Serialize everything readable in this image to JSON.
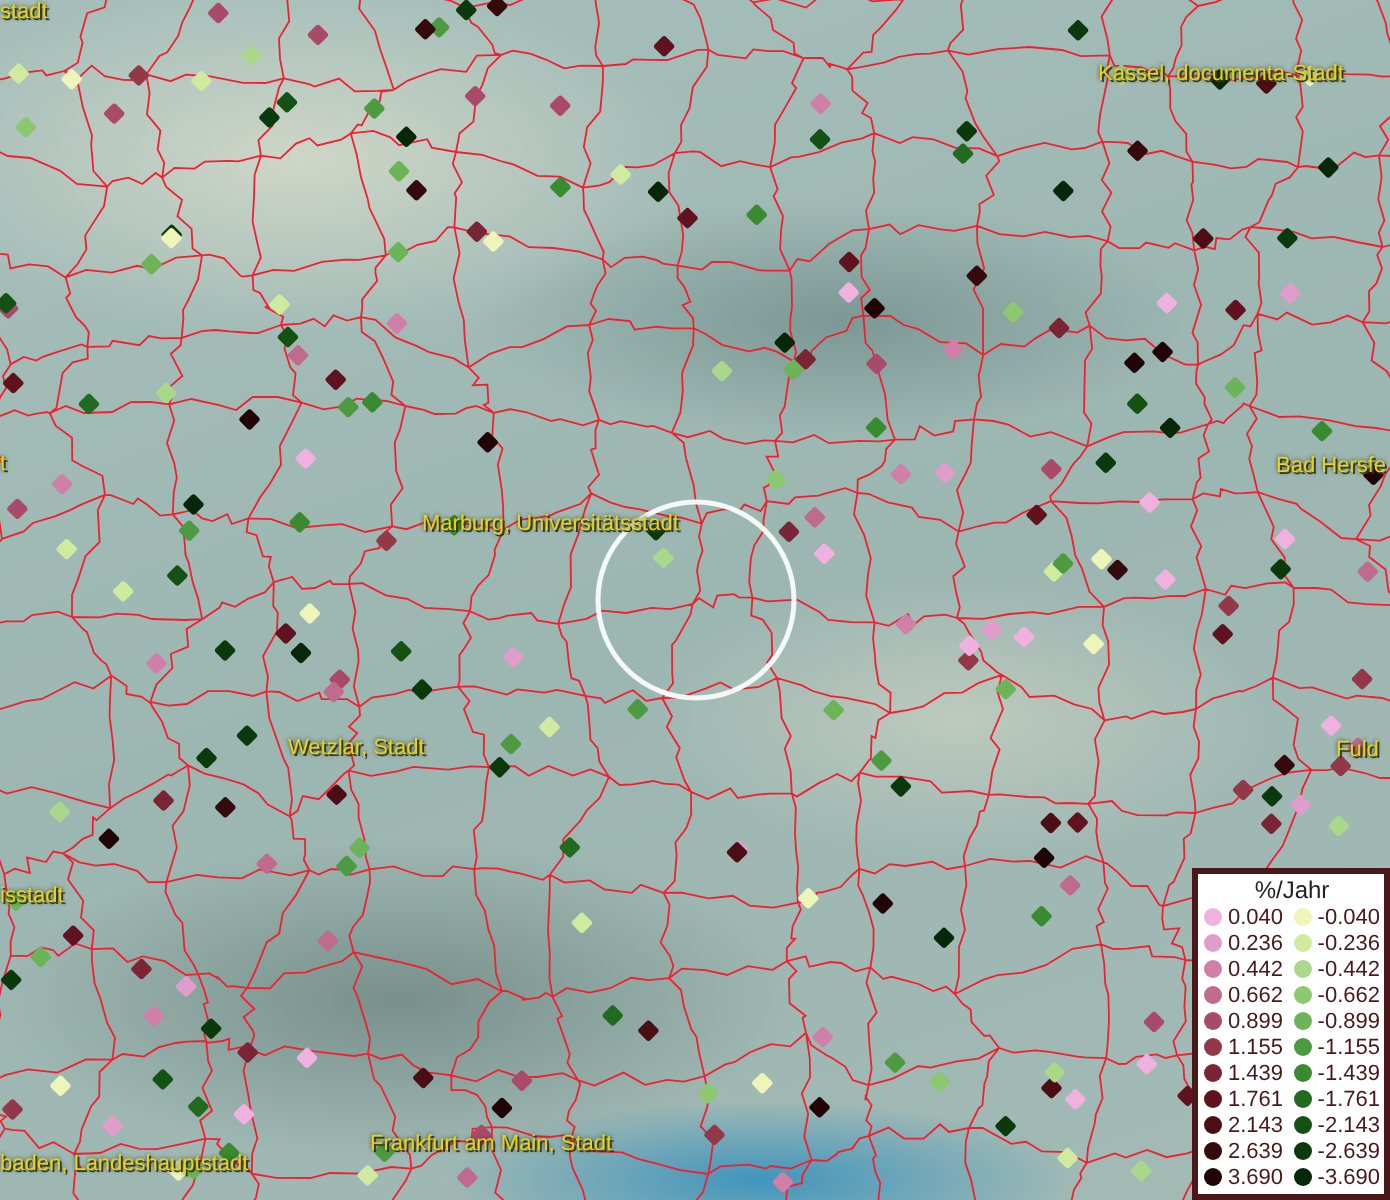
{
  "map": {
    "labels": [
      {
        "text": "stadt"
      },
      {
        "text": "Kassel, documenta-Stadt"
      },
      {
        "text": "t"
      },
      {
        "text": "Bad Hersfe"
      },
      {
        "text": "Marburg, Universitätsstadt"
      },
      {
        "text": "Wetzlar, Stadt"
      },
      {
        "text": "Fuld"
      },
      {
        "text": "isstadt"
      },
      {
        "text": "Frankfurt am Main, Stadt"
      },
      {
        "text": "baden, Landeshauptstadt"
      }
    ]
  },
  "legend": {
    "title": "%/Jahr",
    "positive": [
      {
        "label": "0.040",
        "color": "#f0b0e0"
      },
      {
        "label": "0.236",
        "color": "#e09ccc"
      },
      {
        "label": "0.442",
        "color": "#cf7fa8"
      },
      {
        "label": "0.662",
        "color": "#c06a8e"
      },
      {
        "label": "0.899",
        "color": "#aa4a6a"
      },
      {
        "label": "1.155",
        "color": "#933848"
      },
      {
        "label": "1.439",
        "color": "#7a2535"
      },
      {
        "label": "1.761",
        "color": "#60121e"
      },
      {
        "label": "2.143",
        "color": "#4a0e14"
      },
      {
        "label": "2.639",
        "color": "#350a0c"
      },
      {
        "label": "3.690",
        "color": "#200406"
      }
    ],
    "negative": [
      {
        "label": "-0.040",
        "color": "#eef5b8"
      },
      {
        "label": "-0.236",
        "color": "#d0eaa0"
      },
      {
        "label": "-0.442",
        "color": "#aad88a"
      },
      {
        "label": "-0.662",
        "color": "#8cc870"
      },
      {
        "label": "-0.899",
        "color": "#6cb458"
      },
      {
        "label": "-1.155",
        "color": "#4e9a40"
      },
      {
        "label": "-1.439",
        "color": "#3a8a30"
      },
      {
        "label": "-1.761",
        "color": "#226a20"
      },
      {
        "label": "-2.143",
        "color": "#145214"
      },
      {
        "label": "-2.639",
        "color": "#0a3a0c"
      },
      {
        "label": "-3.690",
        "color": "#062808"
      }
    ]
  }
}
